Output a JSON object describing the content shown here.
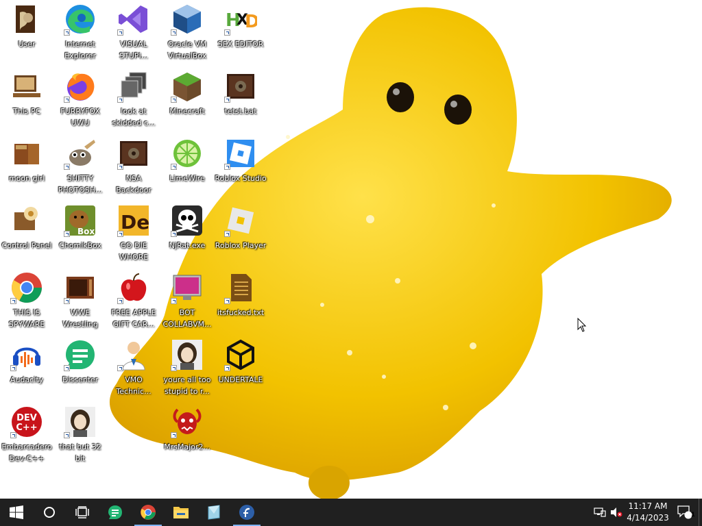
{
  "desktop": {
    "icons": [
      {
        "label": "User",
        "icon": "user-folder-icon"
      },
      {
        "label": "Internet Explorer",
        "icon": "edge-icon"
      },
      {
        "label": "VISUAL STUPI...",
        "icon": "visual-studio-icon"
      },
      {
        "label": "Oracle VM VirtualBox",
        "icon": "virtualbox-icon"
      },
      {
        "label": "SEX EDITOR",
        "icon": "hxd-icon"
      },
      {
        "label": "This PC",
        "icon": "this-pc-icon"
      },
      {
        "label": "FURRYFOX UWU",
        "icon": "firefox-icon"
      },
      {
        "label": "look at skidded c...",
        "icon": "windows-stack-icon"
      },
      {
        "label": "Minecraft",
        "icon": "minecraft-icon"
      },
      {
        "label": "tetst.bat",
        "icon": "batch-file-icon"
      },
      {
        "label": "moon girl",
        "icon": "gramophone-icon"
      },
      {
        "label": "SHITTY PHOTOSH...",
        "icon": "gimp-icon"
      },
      {
        "label": "NSA Backdoor",
        "icon": "batch-file-icon"
      },
      {
        "label": "LimeWire",
        "icon": "limewire-icon"
      },
      {
        "label": "Roblox Studio",
        "icon": "roblox-studio-icon"
      },
      {
        "label": "Control Panel",
        "icon": "control-panel-icon"
      },
      {
        "label": "ChomikBox",
        "icon": "chomikbox-icon"
      },
      {
        "label": "GO DIE WHORE",
        "icon": "de-icon"
      },
      {
        "label": "NjRat.exe",
        "icon": "skull-icon"
      },
      {
        "label": "Roblox Player",
        "icon": "roblox-player-icon"
      },
      {
        "label": "THIS IS SPYWARE",
        "icon": "chrome-icon"
      },
      {
        "label": "WWE Wrestling",
        "icon": "microwave-icon"
      },
      {
        "label": "FREE APPLE GIFT CAR...",
        "icon": "apple-icon"
      },
      {
        "label": "BOT COLLABVM...",
        "icon": "monitor-icon"
      },
      {
        "label": "itsfucked.txt",
        "icon": "text-file-icon"
      },
      {
        "label": "Audacity",
        "icon": "audacity-icon"
      },
      {
        "label": "Dissenter",
        "icon": "dissenter-icon"
      },
      {
        "label": "VMO Technic...",
        "icon": "technician-icon"
      },
      {
        "label": "youre all too stupid to r...",
        "icon": "portrait-icon"
      },
      {
        "label": "UNDERTALE",
        "icon": "unity-icon"
      },
      {
        "label": "Embarcadero Dev-C++",
        "icon": "devcpp-icon"
      },
      {
        "label": "that but 32 bit",
        "icon": "portrait-icon"
      },
      {
        "label": "MrsMajor2...",
        "icon": "demon-icon"
      }
    ]
  },
  "taskbar": {
    "start": "start-icon",
    "search": "cortana-icon",
    "task_view": "task-view-icon",
    "pinned": [
      "dissenter-icon",
      "chrome-icon",
      "file-explorer-icon",
      "hyper-v-icon",
      "firefox-alt-icon"
    ],
    "clock": {
      "time": "11:17 AM",
      "date": "4/14/2023"
    },
    "notifications_count": "1"
  },
  "colors": {
    "taskbar": "#202020",
    "accent": "#7fb3f5",
    "wallpaper_yellow": "#f2c200"
  }
}
